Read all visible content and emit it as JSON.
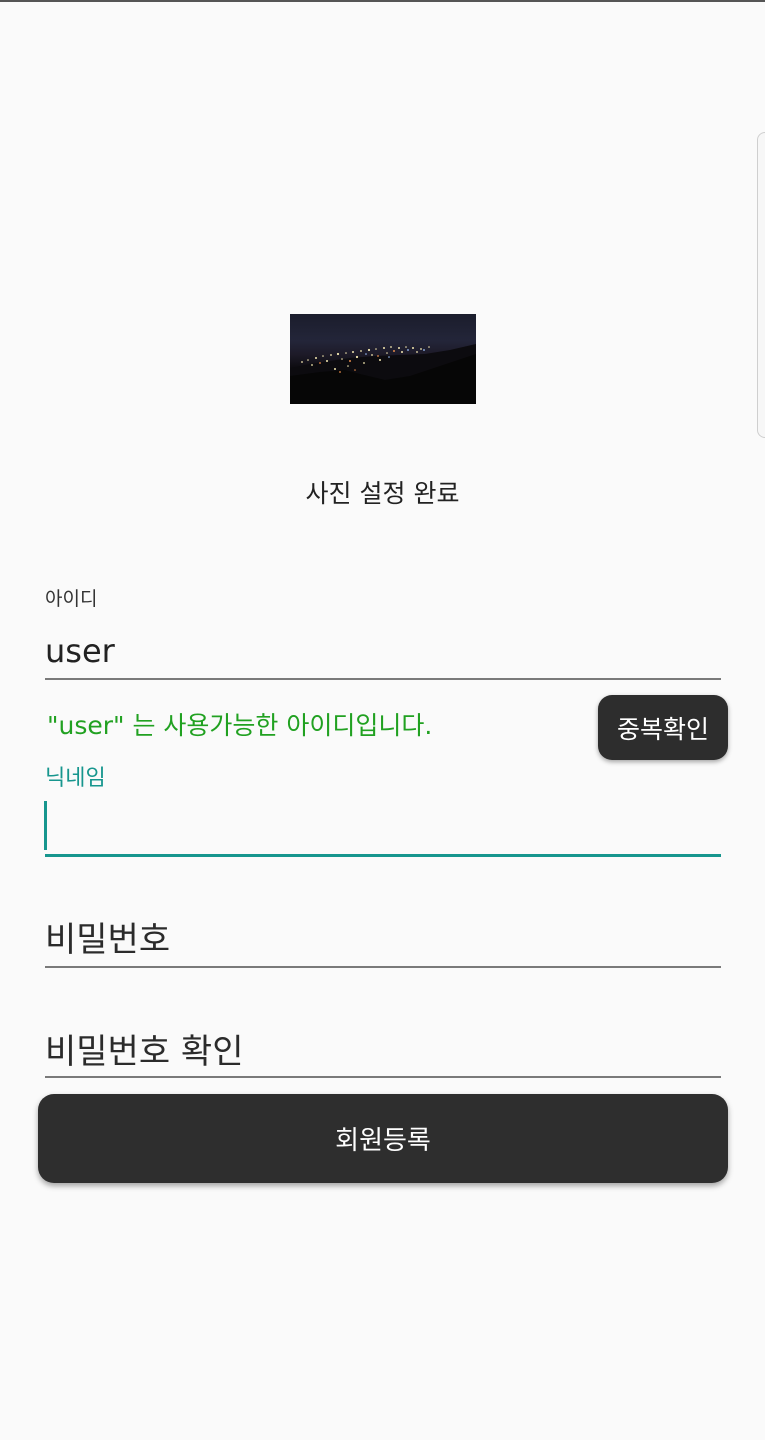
{
  "photo": {
    "status_text": "사진 설정 완료"
  },
  "id_field": {
    "label": "아이디",
    "value": "user",
    "availability_message": "\"user\" 는 사용가능한 아이디입니다.",
    "check_button_label": "중복확인"
  },
  "nickname_field": {
    "label": "닉네임",
    "value": ""
  },
  "password_field": {
    "placeholder": "비밀번호"
  },
  "password_confirm_field": {
    "placeholder": "비밀번호 확인"
  },
  "register_button_label": "회원등록",
  "colors": {
    "accent": "#17968e",
    "success": "#21a121",
    "button_bg": "#2e2e2e",
    "background": "#fafafa"
  }
}
